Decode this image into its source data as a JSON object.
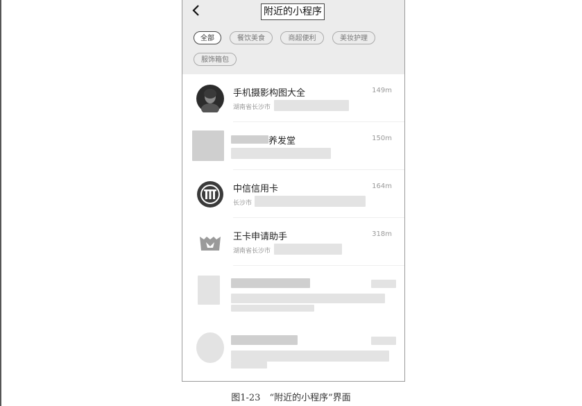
{
  "header": {
    "title": "附近的小程序",
    "back_icon": "chevron-left-icon"
  },
  "categories": [
    "全部",
    "餐饮美食",
    "商超便利",
    "美妆护理",
    "服饰箱包"
  ],
  "items": [
    {
      "name": "手机摄影构图大全",
      "distance": "149m",
      "address": "湖南省长沙市"
    },
    {
      "name": "养发堂",
      "distance": "150m",
      "address": ""
    },
    {
      "name": "中信信用卡",
      "distance": "164m",
      "address": "长沙市"
    },
    {
      "name": "王卡申请助手",
      "distance": "318m",
      "address": "湖南省长沙市"
    }
  ],
  "caption": "图1-23　“附近的小程序”界面"
}
